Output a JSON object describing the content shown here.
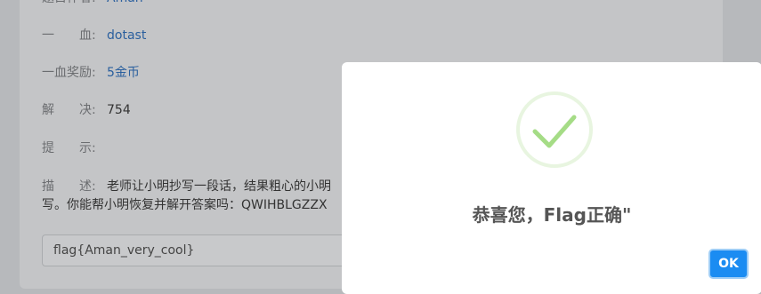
{
  "challenge": {
    "title_label": "题目作者:",
    "title_value": "Aman",
    "first_blood_label": "一　　血:",
    "first_blood_value": "dotast",
    "reward_label": "一血奖励:",
    "reward_value": "5金币",
    "solves_label": "解　　决:",
    "solves_value": "754",
    "hint_label": "提　　示:",
    "hint_value": "",
    "desc_label": "描　　述:",
    "desc_line1": "老师让小明抄写一段话，结果粗心的小明",
    "desc_line2": "写。你能帮小明恢复并解开答案吗：QWIHBLGZZX"
  },
  "flag_input": {
    "value": "flag{Aman_very_cool}"
  },
  "modal": {
    "icon": "success-check-icon",
    "title": "恭喜您，Flag正确\"",
    "ok_label": "OK",
    "accent_color": "#1b8cf2",
    "check_color": "#a5dc86"
  }
}
